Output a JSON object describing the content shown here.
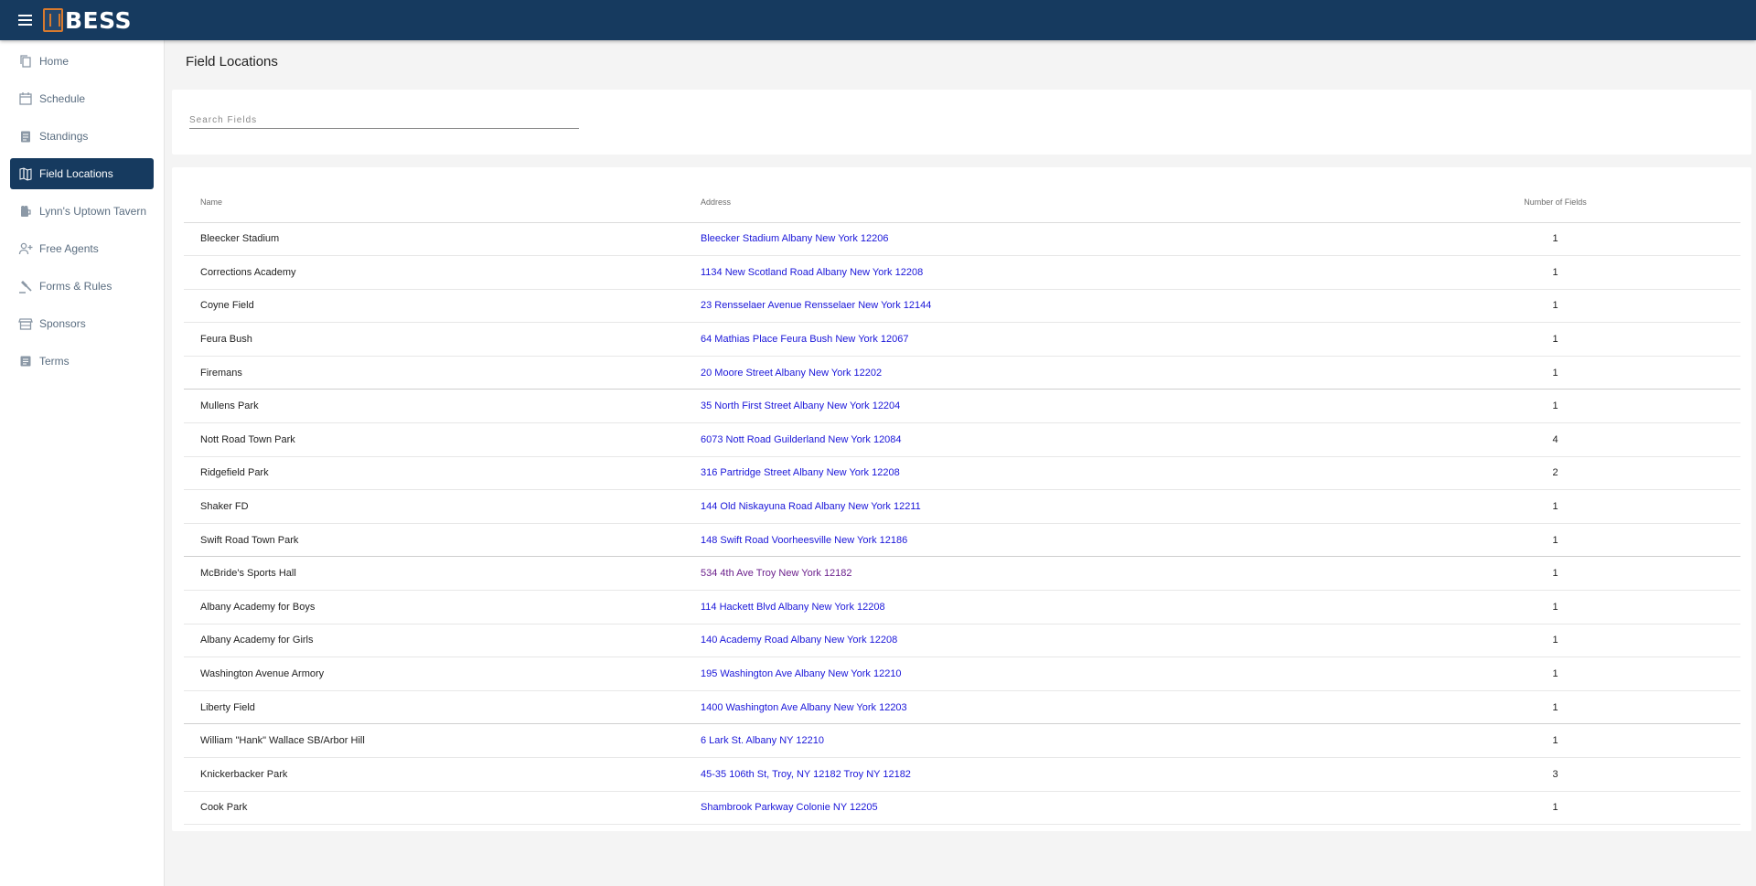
{
  "app": {
    "logo_text": "BESS"
  },
  "sidebar": {
    "items": [
      {
        "label": "Home",
        "icon": "copy-icon"
      },
      {
        "label": "Schedule",
        "icon": "calendar-icon"
      },
      {
        "label": "Standings",
        "icon": "clipboard-icon"
      },
      {
        "label": "Field Locations",
        "icon": "map-icon",
        "active": true
      },
      {
        "label": "Lynn's Uptown Tavern",
        "icon": "beer-icon"
      },
      {
        "label": "Free Agents",
        "icon": "add-user-icon"
      },
      {
        "label": "Forms & Rules",
        "icon": "gavel-icon"
      },
      {
        "label": "Sponsors",
        "icon": "store-icon"
      },
      {
        "label": "Terms",
        "icon": "document-icon"
      }
    ]
  },
  "page": {
    "title": "Field Locations"
  },
  "search": {
    "placeholder": "Search Fields"
  },
  "table": {
    "headers": {
      "name": "Name",
      "address": "Address",
      "fields": "Number of Fields"
    },
    "rows": [
      {
        "name": "Bleecker Stadium",
        "address": "Bleecker Stadium Albany New York 12206",
        "fields": "1"
      },
      {
        "name": "Corrections Academy",
        "address": "1134 New Scotland Road Albany New York 12208",
        "fields": "1"
      },
      {
        "name": "Coyne Field",
        "address": "23 Rensselaer Avenue Rensselaer New York 12144",
        "fields": "1"
      },
      {
        "name": "Feura Bush",
        "address": "64 Mathias Place Feura Bush New York 12067",
        "fields": "1"
      },
      {
        "name": "Firemans",
        "address": "20 Moore Street Albany New York 12202",
        "fields": "1"
      },
      {
        "name": "Mullens Park",
        "address": "35 North First Street Albany New York 12204",
        "fields": "1"
      },
      {
        "name": "Nott Road Town Park",
        "address": "6073 Nott Road Guilderland New York 12084",
        "fields": "4"
      },
      {
        "name": "Ridgefield Park",
        "address": "316 Partridge Street Albany New York 12208",
        "fields": "2"
      },
      {
        "name": "Shaker FD",
        "address": "144 Old Niskayuna Road Albany New York 12211",
        "fields": "1"
      },
      {
        "name": "Swift Road Town Park",
        "address": "148 Swift Road Voorheesville New York 12186",
        "fields": "1"
      },
      {
        "name": "McBride's Sports Hall",
        "address": "534 4th Ave Troy New York 12182",
        "fields": "1",
        "visited": true
      },
      {
        "name": "Albany Academy for Boys",
        "address": "114 Hackett Blvd Albany New York 12208",
        "fields": "1"
      },
      {
        "name": "Albany Academy for Girls",
        "address": "140 Academy Road Albany New York 12208",
        "fields": "1"
      },
      {
        "name": "Washington Avenue Armory",
        "address": "195 Washington Ave Albany New York 12210",
        "fields": "1"
      },
      {
        "name": "Liberty Field",
        "address": "1400 Washington Ave Albany New York 12203",
        "fields": "1"
      },
      {
        "name": "William \"Hank\" Wallace SB/Arbor Hill",
        "address": "6 Lark St. Albany NY 12210",
        "fields": "1"
      },
      {
        "name": "Knickerbacker Park",
        "address": "45-35 106th St, Troy, NY 12182 Troy NY 12182",
        "fields": "3"
      },
      {
        "name": "Cook Park",
        "address": "Shambrook Parkway Colonie NY 12205",
        "fields": "1"
      }
    ]
  },
  "colors": {
    "topbar": "#163a5f",
    "active_nav": "#163a5f",
    "link": "#1a16d9",
    "visited_link": "#6b1f8c",
    "logo_accent": "#d87a2e"
  }
}
